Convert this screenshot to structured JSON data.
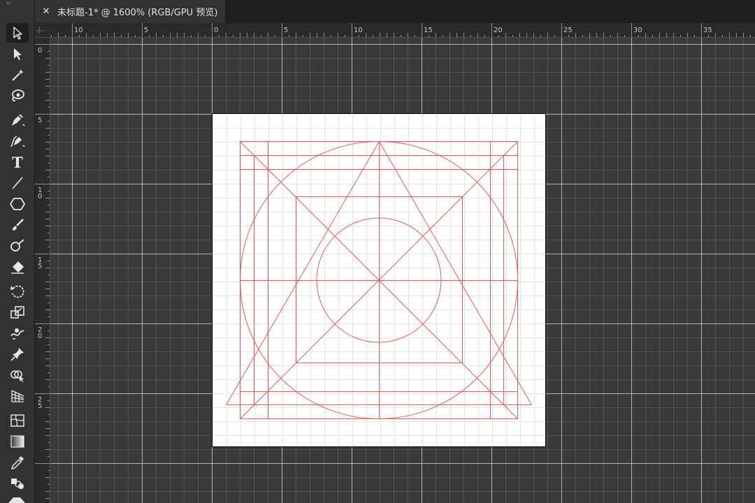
{
  "app": {
    "document_tab": {
      "close_label": "✕",
      "title": "未标题-1* @ 1600% (RGB/GPU 预览)"
    },
    "toolbar_grip": "››"
  },
  "tools": [
    {
      "name": "selection-tool",
      "icon": "arrow-outline-icon",
      "active": true
    },
    {
      "name": "direct-selection-tool",
      "icon": "arrow-filled-icon"
    },
    {
      "name": "magic-wand-tool",
      "icon": "magic-wand-icon"
    },
    {
      "name": "lasso-tool",
      "icon": "lasso-icon"
    },
    {
      "name": "pen-tool",
      "icon": "pen-icon"
    },
    {
      "name": "curvature-tool",
      "icon": "curvature-pen-icon"
    },
    {
      "name": "type-tool",
      "icon": "type-t-icon",
      "glyph": "T"
    },
    {
      "name": "line-tool",
      "icon": "line-segment-icon"
    },
    {
      "name": "polygon-tool",
      "icon": "hexagon-icon"
    },
    {
      "name": "paintbrush-tool",
      "icon": "brush-icon"
    },
    {
      "name": "shaper-tool",
      "icon": "shaper-icon"
    },
    {
      "name": "eraser-tool",
      "icon": "eraser-icon"
    },
    {
      "name": "rotate-tool",
      "icon": "rotate-icon"
    },
    {
      "name": "scale-tool",
      "icon": "scale-icon"
    },
    {
      "name": "warp-tool",
      "icon": "warp-icon"
    },
    {
      "name": "puppet-warp-tool",
      "icon": "pin-icon"
    },
    {
      "name": "shape-builder-tool",
      "icon": "shape-builder-icon"
    },
    {
      "name": "perspective-grid-tool",
      "icon": "perspective-grid-icon"
    },
    {
      "name": "mesh-tool",
      "icon": "mesh-icon"
    },
    {
      "name": "gradient-tool",
      "icon": "gradient-icon"
    },
    {
      "name": "eyedropper-tool",
      "icon": "eyedropper-icon"
    },
    {
      "name": "blend-tool",
      "icon": "blend-icon"
    }
  ],
  "rulers": {
    "horizontal_labels": [
      "10",
      "5",
      "0",
      "5",
      "10",
      "15",
      "20",
      "25",
      "30",
      "35"
    ],
    "vertical_labels": [
      [
        "0"
      ],
      [
        "5"
      ],
      [
        "1",
        "0"
      ],
      [
        "1",
        "5"
      ],
      [
        "2",
        "0"
      ],
      [
        "2",
        "5"
      ]
    ]
  },
  "colors": {
    "guide_stroke": "#e85a5a",
    "pasteboard": "#3a3a3a",
    "artboard": "#ffffff"
  }
}
